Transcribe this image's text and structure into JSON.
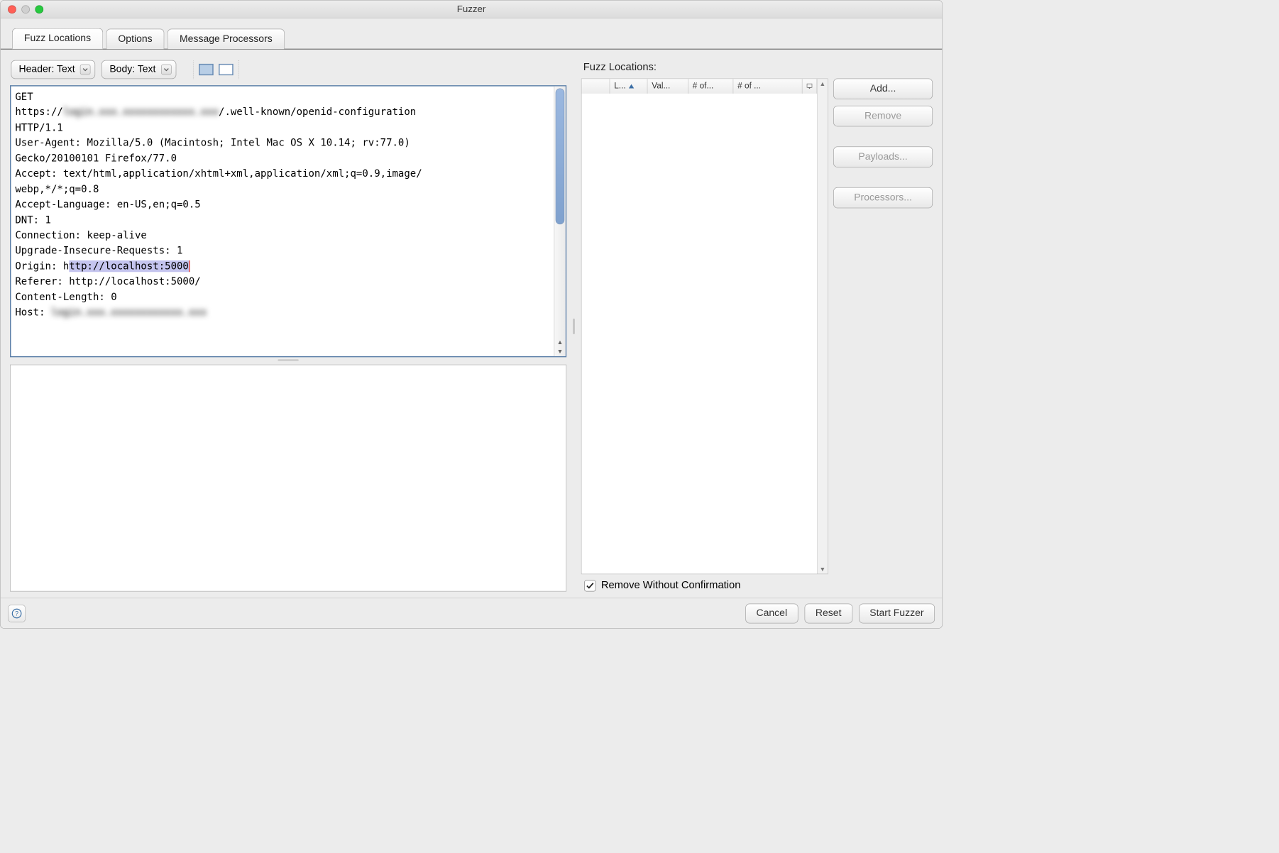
{
  "window": {
    "title": "Fuzzer"
  },
  "tabs": [
    "Fuzz Locations",
    "Options",
    "Message Processors"
  ],
  "toolbar": {
    "header_select": "Header: Text",
    "body_select": "Body: Text"
  },
  "request": {
    "l1": "GET",
    "l2a": "https://",
    "l2blur": "login.xxx.xxxxxxxxxxxx.xxx",
    "l2b": "/.well-known/openid-configuration",
    "l3": "HTTP/1.1",
    "l4": "User-Agent: Mozilla/5.0 (Macintosh; Intel Mac OS X 10.14; rv:77.0)",
    "l5": "Gecko/20100101 Firefox/77.0",
    "l6": "Accept: text/html,application/xhtml+xml,application/xml;q=0.9,image/",
    "l7": "webp,*/*;q=0.8",
    "l8": "Accept-Language: en-US,en;q=0.5",
    "l9": "DNT: 1",
    "l10": "Connection: keep-alive",
    "l11": "Upgrade-Insecure-Requests: 1",
    "l12a": "Origin: h",
    "l12hl": "ttp://localhost:5000",
    "l13": "Referer: http://localhost:5000/",
    "l14": "Content-Length: 0",
    "l15a": "Host: ",
    "l15blur": "login.xxx.xxxxxxxxxxxx.xxx"
  },
  "right": {
    "heading": "Fuzz Locations:",
    "cols": [
      "L...",
      "Val...",
      "# of...",
      "# of ..."
    ],
    "buttons": {
      "add": "Add...",
      "remove": "Remove",
      "payloads": "Payloads...",
      "processors": "Processors..."
    },
    "remove_without_confirmation": "Remove Without Confirmation",
    "remove_without_confirmation_checked": true
  },
  "footer": {
    "cancel": "Cancel",
    "reset": "Reset",
    "start": "Start Fuzzer"
  }
}
